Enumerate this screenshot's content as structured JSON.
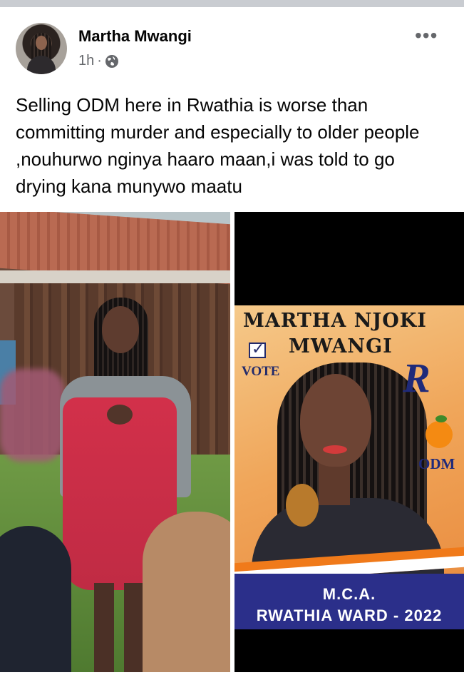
{
  "post": {
    "author": "Martha Mwangi",
    "time": "1h",
    "separator": "·",
    "audience_icon": "globe-icon",
    "more_icon": "more-options-icon",
    "more_label": "•••",
    "caption": "Selling ODM here in Rwathia is worse than committing murder and especially to older people ,nouhurwo  nginya haaro maan,i was told to go drying kana munywo maatu"
  },
  "poster": {
    "name_line1": "MARTHA NJOKI",
    "name_line2": "MWANGI",
    "vote_label": "VOTE",
    "vote_check": "✓",
    "party_logo_letter": "R",
    "party_label": "ODM",
    "office": "M.C.A.",
    "ward": "RWATHIA WARD - 2022"
  },
  "colors": {
    "poster_blue": "#2b2f8a",
    "poster_orange": "#f07a1a",
    "meta_gray": "#65676b"
  }
}
